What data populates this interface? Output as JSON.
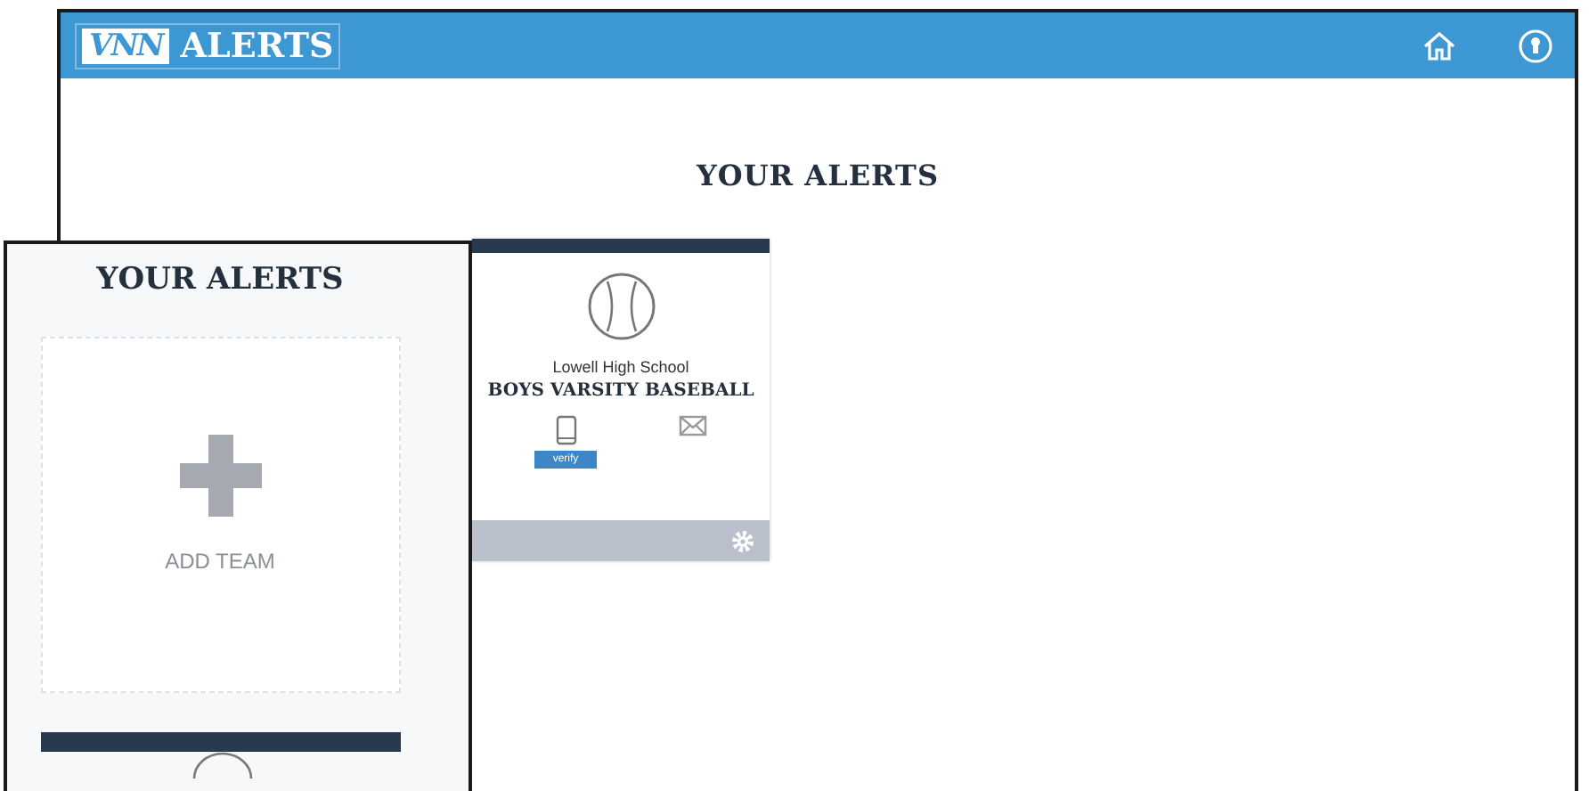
{
  "desktop": {
    "logo": {
      "mark": "VNN",
      "title": "ALERTS"
    },
    "heading": "YOUR ALERTS",
    "cards": [
      {
        "school": "Lowell High School",
        "team": "BOYS VARSITY BASEBALL",
        "verify_button": "verify"
      }
    ]
  },
  "mobile": {
    "heading": "YOUR ALERTS",
    "add_team": "ADD TEAM"
  }
}
